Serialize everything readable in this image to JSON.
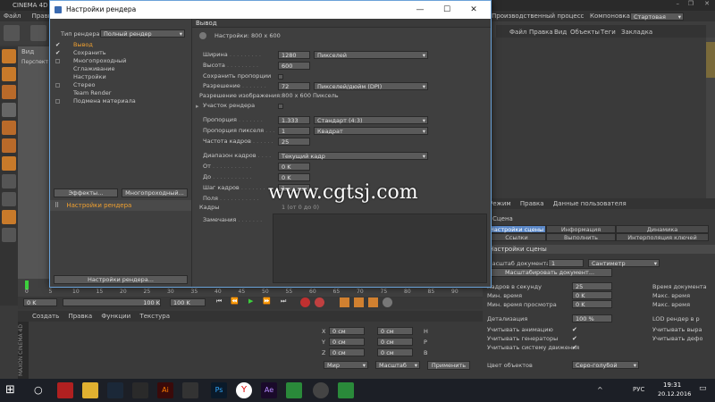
{
  "app_title": "CINEMA 4D R",
  "main_menu": [
    "Файл",
    "Правка"
  ],
  "layout": {
    "label": "Компоновка",
    "value": "Стартовая",
    "right_title": "Производственный процесс"
  },
  "om_menu": [
    "Файл",
    "Правка",
    "Вид",
    "Объекты",
    "Теги",
    "Закладка"
  ],
  "viewport": {
    "tab": "Вид",
    "label": "Перспект"
  },
  "dialog": {
    "title": "Настройки рендера",
    "render_type_label": "Тип рендера",
    "render_type_value": "Полный рендер",
    "tree": [
      {
        "label": "Вывод",
        "checked": true,
        "active": true
      },
      {
        "label": "Сохранить",
        "checked": true
      },
      {
        "label": "Многопроходный",
        "checked": false
      },
      {
        "label": "Сглаживание",
        "checked": false
      },
      {
        "label": "Настройки",
        "checked": false
      },
      {
        "label": "Стерео",
        "checked": false
      },
      {
        "label": "Team Render",
        "checked": false
      },
      {
        "label": "Подмена материала",
        "checked": false
      }
    ],
    "btn_effects": "Эффекты...",
    "btn_multipass": "Многопроходный...",
    "preset": "Настройки рендера",
    "btn_render_settings": "Настройки рендера...",
    "section": "Вывод",
    "preset_info": "Настройки: 800 x 600",
    "fields": {
      "width_label": "Ширина",
      "width": "1280",
      "width_unit": "Пикселей",
      "height_label": "Высота",
      "height": "600",
      "keep_ratio": "Сохранить пропорции",
      "resolution_label": "Разрешение",
      "resolution": "72",
      "resolution_unit": "Пикселей/дюйм (DPI)",
      "image_resolution": "Разрешение изображения:800 x 600 Пиксель",
      "region": "Участок рендера",
      "ratio_label": "Пропорция",
      "ratio": "1.333",
      "ratio_type": "Стандарт (4:3)",
      "pixel_label": "Пропорция пикселя",
      "pixel": "1",
      "pixel_type": "Квадрат",
      "fps_label": "Частота кадров",
      "fps": "25",
      "range_label": "Диапазон кадров",
      "range": "Текущий кадр",
      "from_label": "От",
      "from": "0 K",
      "to_label": "До",
      "to": "0 K",
      "step_label": "Шаг кадров",
      "step": "1",
      "fields_label": "Поля",
      "frames_label": "Кадры",
      "frames_value": "1 (от 0 до 0)",
      "notes_label": "Замечания"
    }
  },
  "attr": {
    "menu": [
      "Режим",
      "Правка",
      "Данные пользователя"
    ],
    "title": "Сцена",
    "tabs_row1": [
      "Настройки сцены",
      "Информация",
      "Динамика"
    ],
    "tabs_row2": [
      "Ссылки",
      "Выполнить",
      "Интерполяция ключей"
    ],
    "section": "Настройки сцены",
    "scale_label": "Масштаб документа",
    "scale_value": "1",
    "scale_unit": "Сантиметр",
    "scale_btn": "Масштабировать документ...",
    "fps_label": "Кадров в секунду",
    "fps": "25",
    "min_time_label": "Мин. время",
    "min_time": "0 K",
    "min_preview_label": "Мин. время просмотра",
    "min_preview": "0 K",
    "detail_label": "Детализация",
    "detail": "100 %",
    "anim_label": "Учитывать анимацию",
    "gen_label": "Учитывать генераторы",
    "motion_label": "Учитывать систему движения",
    "color_label": "Цвет объектов",
    "color_value": "Серо-голубой",
    "r1": "Время документа",
    "r2": "Макс. время",
    "r3": "Макс. время",
    "r4": "LOD рендер в р",
    "r5": "Учитывать выра",
    "r6": "Учитывать дефо"
  },
  "timeline": {
    "ticks": [
      "0",
      "5",
      "10",
      "15",
      "20",
      "25",
      "30",
      "35",
      "40",
      "45",
      "50",
      "55",
      "60",
      "65",
      "70",
      "75",
      "80",
      "85",
      "90"
    ],
    "start": "0 K",
    "end": "100 K",
    "current": "0 K",
    "end2": "100 K"
  },
  "material_menu": [
    "Создать",
    "Правка",
    "Функции",
    "Текстура"
  ],
  "coords": {
    "x": "X",
    "y": "Y",
    "z": "Z",
    "val": "0 см",
    "h": "H",
    "p": "P",
    "b": "B",
    "world": "Мир",
    "size": "Масштаб",
    "apply": "Применить"
  },
  "watermark": "www.cgtsj.com",
  "taskbar": {
    "lang": "РУС",
    "time": "19:31",
    "date": "20.12.2016"
  }
}
